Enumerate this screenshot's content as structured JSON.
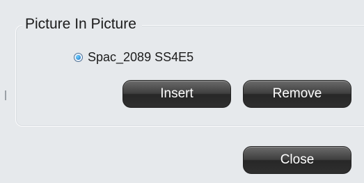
{
  "group": {
    "title": "Picture In Picture"
  },
  "source": {
    "label": "Spac_2089 SS4E5",
    "selected": true
  },
  "buttons": {
    "insert": "Insert",
    "remove": "Remove",
    "close": "Close"
  },
  "colors": {
    "button_top": "#6b6b6b",
    "button_bottom": "#272727",
    "background": "#e6e9ec",
    "radio_fill": "#1d6fc2"
  }
}
